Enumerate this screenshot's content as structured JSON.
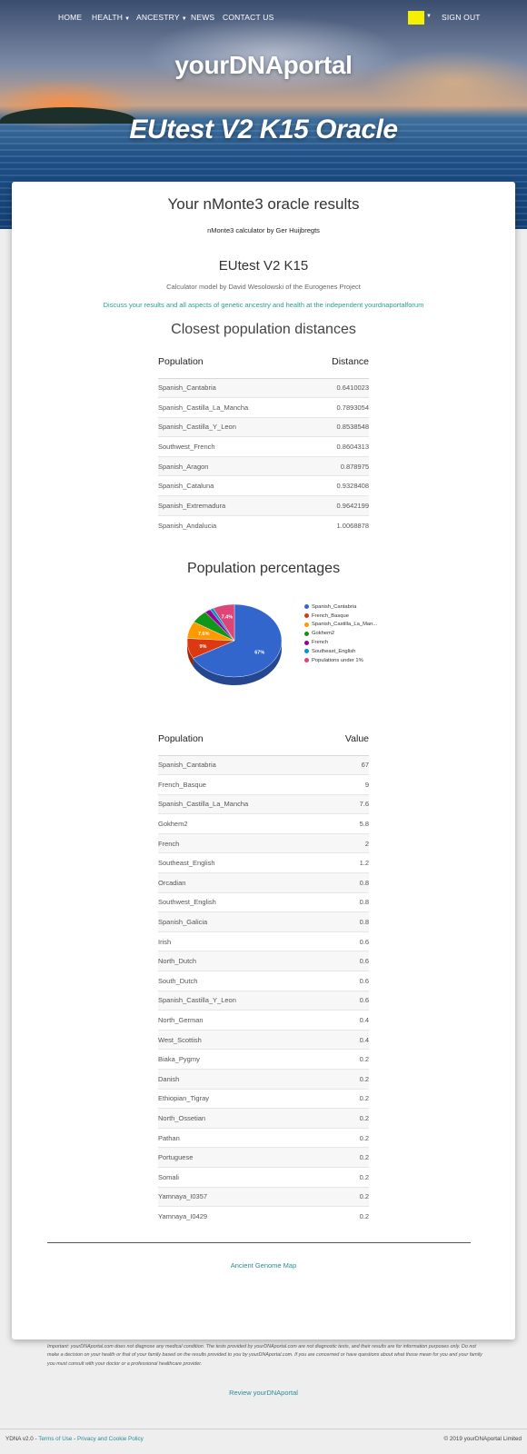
{
  "nav": {
    "home": "HOME",
    "health": "HEALTH",
    "ancestry": "ANCESTRY",
    "news": "NEWS",
    "contact": "CONTACT US",
    "signout": "SIGN OUT",
    "flag_color": "#f5f000"
  },
  "hero": {
    "site_title": "yourDNAportal",
    "test_title": "EUtest V2 K15 Oracle"
  },
  "results": {
    "heading": "Your nMonte3 oracle results",
    "calculator_credit": "nMonte3 calculator by Ger Huijbregts",
    "test_name": "EUtest V2 K15",
    "model_credit": "Calculator model by David Wesolowski of the Eurogenes Project",
    "discuss_link": "Discuss your results and all aspects of genetic ancestry and health at the independent yourdnaportalforum"
  },
  "distances": {
    "heading": "Closest population distances",
    "col_population": "Population",
    "col_distance": "Distance",
    "rows": [
      {
        "population": "Spanish_Cantabria",
        "distance": "0.6410023"
      },
      {
        "population": "Spanish_Castilla_La_Mancha",
        "distance": "0.7893054"
      },
      {
        "population": "Spanish_Castilla_Y_Leon",
        "distance": "0.8538548"
      },
      {
        "population": "Southwest_French",
        "distance": "0.8604313"
      },
      {
        "population": "Spanish_Aragon",
        "distance": "0.878975"
      },
      {
        "population": "Spanish_Cataluna",
        "distance": "0.9328408"
      },
      {
        "population": "Spanish_Extremadura",
        "distance": "0.9642199"
      },
      {
        "population": "Spanish_Andalucia",
        "distance": "1.0068878"
      }
    ]
  },
  "percentages": {
    "heading": "Population percentages",
    "col_population": "Population",
    "col_value": "Value",
    "rows": [
      {
        "population": "Spanish_Cantabria",
        "value": "67"
      },
      {
        "population": "French_Basque",
        "value": "9"
      },
      {
        "population": "Spanish_Castilla_La_Mancha",
        "value": "7.6"
      },
      {
        "population": "Gokhem2",
        "value": "5.8"
      },
      {
        "population": "French",
        "value": "2"
      },
      {
        "population": "Southeast_English",
        "value": "1.2"
      },
      {
        "population": "Orcadian",
        "value": "0.8"
      },
      {
        "population": "Southwest_English",
        "value": "0.8"
      },
      {
        "population": "Spanish_Galicia",
        "value": "0.8"
      },
      {
        "population": "Irish",
        "value": "0.6"
      },
      {
        "population": "North_Dutch",
        "value": "0.6"
      },
      {
        "population": "South_Dutch",
        "value": "0.6"
      },
      {
        "population": "Spanish_Castilla_Y_Leon",
        "value": "0.6"
      },
      {
        "population": "North_German",
        "value": "0.4"
      },
      {
        "population": "West_Scottish",
        "value": "0.4"
      },
      {
        "population": "Biaka_Pygmy",
        "value": "0.2"
      },
      {
        "population": "Danish",
        "value": "0.2"
      },
      {
        "population": "Ethiopian_Tigray",
        "value": "0.2"
      },
      {
        "population": "North_Ossetian",
        "value": "0.2"
      },
      {
        "population": "Pathan",
        "value": "0.2"
      },
      {
        "population": "Portuguese",
        "value": "0.2"
      },
      {
        "population": "Somali",
        "value": "0.2"
      },
      {
        "population": "Yamnaya_I0357",
        "value": "0.2"
      },
      {
        "population": "Yamnaya_I0429",
        "value": "0.2"
      }
    ]
  },
  "chart_data": {
    "type": "pie",
    "categories": [
      "Spanish_Cantabria",
      "French_Basque",
      "Spanish_Castilla_La_Man...",
      "Gokhem2",
      "French",
      "Southeast_English",
      "Populations under 1%"
    ],
    "values": [
      67,
      9,
      7.6,
      5.8,
      2,
      1.2,
      7.4
    ],
    "colors": [
      "#3366cc",
      "#dc3912",
      "#ff9900",
      "#109618",
      "#990099",
      "#0099c6",
      "#dd4477"
    ],
    "slice_labels": [
      "67%",
      "9%",
      "7.6%",
      "",
      "",
      "",
      "7.4%"
    ],
    "legend_position": "right",
    "three_d": true
  },
  "links": {
    "ancient_genome_map": "Ancient Genome Map",
    "review": "Review yourDNAportal"
  },
  "disclaimer": "Important: yourDNAportal.com does not diagnose any medical condition. The tests provided by yourDNAportal.com are not diagnostic tests, and their results are for information purposes only. Do not make a decision on your health or that of your family based on the results provided to you by yourDNAportal.com. If you are concerned or have questions about what those mean for you and your family you must consult with your doctor or a professional healthcare provider.",
  "footer": {
    "version": "YDNA v2.0",
    "separator": " - ",
    "terms": "Terms of Use",
    "privacy": "Privacy and Cookie Policy",
    "copyright": "© 2019 yourDNAportal Limited"
  }
}
